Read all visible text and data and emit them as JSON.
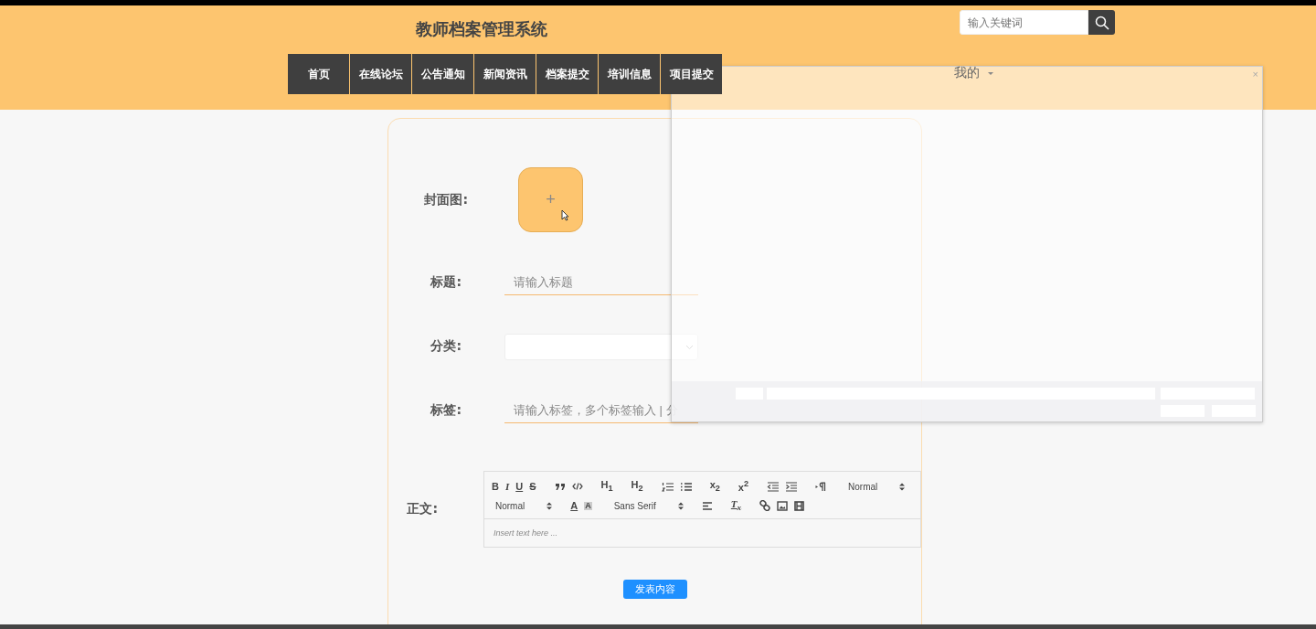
{
  "header": {
    "title": "教师档案管理系统",
    "search": {
      "placeholder": "输入关键词"
    },
    "nav": [
      {
        "label": "首页"
      },
      {
        "label": "在线论坛"
      },
      {
        "label": "公告通知"
      },
      {
        "label": "新闻资讯"
      },
      {
        "label": "档案提交"
      },
      {
        "label": "培训信息"
      },
      {
        "label": "项目提交"
      }
    ],
    "user_menu": {
      "label": "我的"
    }
  },
  "form": {
    "fields": [
      {
        "kind": "upload",
        "label": "封面图:",
        "text": "+"
      },
      {
        "kind": "input",
        "label": "标题:",
        "placeholder": "请输入标题"
      },
      {
        "kind": "select",
        "label": "分类:"
      },
      {
        "kind": "input",
        "label": "标签:",
        "placeholder": "请输入标签，多个标签输入 | 分"
      },
      {
        "kind": "editor",
        "label": "正文:",
        "placeholder": "Insert text here ..."
      }
    ],
    "toolbar": [
      [
        {
          "kind": "bold",
          "text": "B"
        },
        {
          "kind": "italic",
          "text": "I"
        },
        {
          "kind": "underline",
          "text": "U"
        },
        {
          "kind": "strike",
          "text": "S"
        },
        {
          "kind": "quote"
        },
        {
          "kind": "code"
        },
        {
          "kind": "header",
          "text": "H$_{1}$"
        },
        {
          "kind": "header",
          "text": "H$_{2}$"
        },
        {
          "kind": "ol"
        },
        {
          "kind": "ul"
        },
        {
          "kind": "script",
          "text": "x$_{2}$"
        },
        {
          "kind": "script",
          "text": "x$^{2}$"
        },
        {
          "kind": "outdent"
        },
        {
          "kind": "indent"
        },
        {
          "kind": "direction"
        },
        {
          "kind": "picker",
          "text": "Normal"
        }
      ],
      [
        {
          "kind": "picker",
          "text": "Normal"
        },
        {
          "kind": "color",
          "text": "A"
        },
        {
          "kind": "background",
          "text": "A"
        },
        {
          "kind": "picker",
          "text": "Sans Serif"
        },
        {
          "kind": "align"
        },
        {
          "kind": "clean",
          "text": "T$_{x}$"
        },
        {
          "kind": "link"
        },
        {
          "kind": "image"
        },
        {
          "kind": "video"
        }
      ]
    ],
    "submit": "发表内容"
  },
  "overlay": {
    "close": "×"
  }
}
